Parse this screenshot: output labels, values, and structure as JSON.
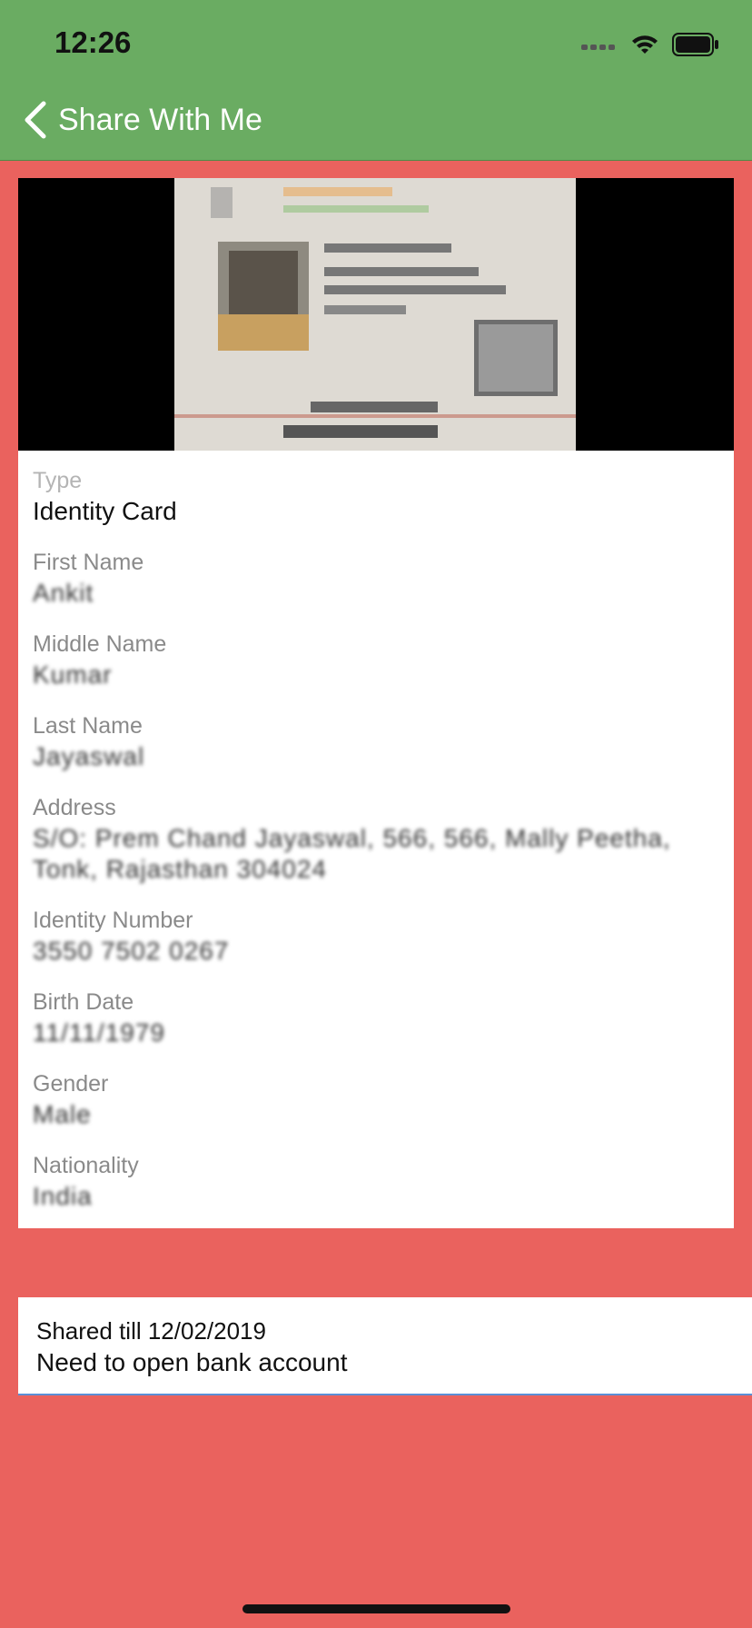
{
  "status_bar": {
    "time": "12:26"
  },
  "nav": {
    "back_label": "Share With Me"
  },
  "document": {
    "fields": [
      {
        "label": "Type",
        "value": "Identity Card"
      },
      {
        "label": "First Name",
        "value": "Ankit"
      },
      {
        "label": "Middle Name",
        "value": "Kumar"
      },
      {
        "label": "Last Name",
        "value": "Jayaswal"
      },
      {
        "label": "Address",
        "value": "S/O: Prem Chand Jayaswal, 566, 566, Mally Peetha, Tonk, Rajasthan 304024"
      },
      {
        "label": "Identity Number",
        "value": "3550 7502 0267"
      },
      {
        "label": "Birth Date",
        "value": "11/11/1979"
      },
      {
        "label": "Gender",
        "value": "Male"
      },
      {
        "label": "Nationality",
        "value": "India"
      }
    ]
  },
  "share": {
    "shared_till": "Shared till 12/02/2019",
    "reason": "Need to open bank account"
  },
  "colors": {
    "header": "#6aac62",
    "background": "#ea625e",
    "card": "#ffffff"
  }
}
